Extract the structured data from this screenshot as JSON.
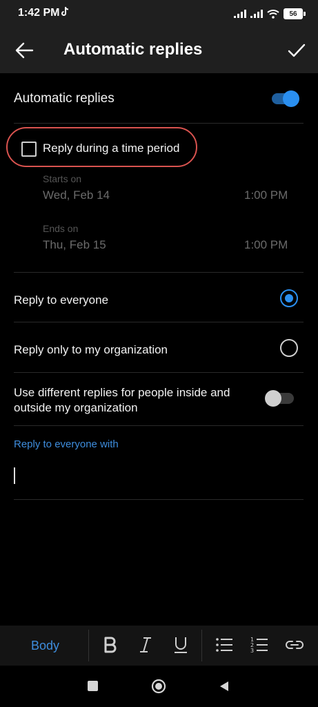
{
  "status_bar": {
    "time": "1:42 PM",
    "battery": "56"
  },
  "header": {
    "title": "Automatic replies"
  },
  "automatic_replies": {
    "label": "Automatic replies",
    "enabled": true
  },
  "time_period": {
    "checkbox_label": "Reply during a time period",
    "checked": false,
    "starts_label": "Starts on",
    "starts_date": "Wed, Feb 14",
    "starts_time": "1:00 PM",
    "ends_label": "Ends on",
    "ends_date": "Thu, Feb 15",
    "ends_time": "1:00 PM"
  },
  "reply_options": {
    "everyone_label": "Reply to everyone",
    "org_label": "Reply only to my organization",
    "selected": "everyone"
  },
  "different_replies": {
    "line1": "Use different replies for people inside and",
    "line2": "outside my organization",
    "enabled": false
  },
  "message": {
    "label": "Reply to everyone with",
    "value": ""
  },
  "toolbar": {
    "body_label": "Body"
  },
  "colors": {
    "accent": "#2a8ff0",
    "highlight": "#d9534f",
    "background": "#000000"
  }
}
